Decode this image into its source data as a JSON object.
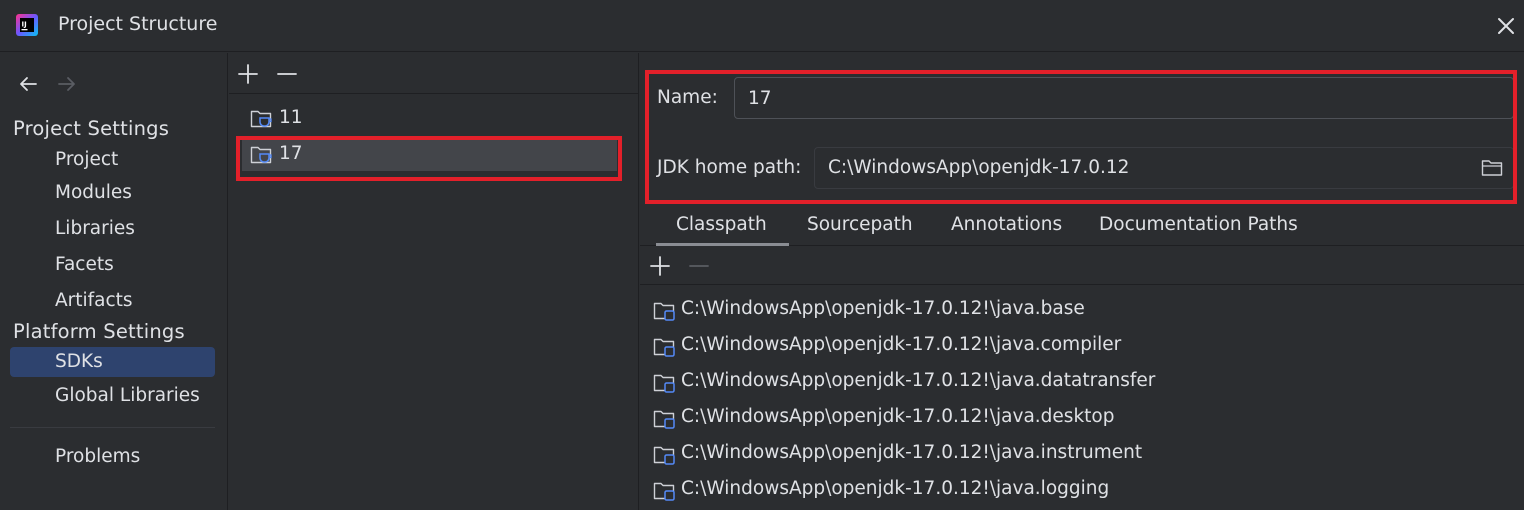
{
  "window": {
    "title": "Project Structure"
  },
  "sidebar": {
    "project_settings_label": "Project Settings",
    "platform_settings_label": "Platform Settings",
    "items": [
      {
        "label": "Project"
      },
      {
        "label": "Modules"
      },
      {
        "label": "Libraries"
      },
      {
        "label": "Facets"
      },
      {
        "label": "Artifacts"
      },
      {
        "label": "SDKs"
      },
      {
        "label": "Global Libraries"
      },
      {
        "label": "Problems"
      }
    ],
    "selected": "SDKs"
  },
  "sdk_list": {
    "items": [
      {
        "label": "11"
      },
      {
        "label": "17"
      }
    ],
    "selected": "17"
  },
  "details": {
    "name_label": "Name:",
    "name_value": "17",
    "home_label": "JDK home path:",
    "home_value": "C:\\WindowsApp\\openjdk-17.0.12"
  },
  "tabs": [
    {
      "label": "Classpath"
    },
    {
      "label": "Sourcepath"
    },
    {
      "label": "Annotations"
    },
    {
      "label": "Documentation Paths"
    }
  ],
  "active_tab": "Classpath",
  "classpath": [
    "C:\\WindowsApp\\openjdk-17.0.12!\\java.base",
    "C:\\WindowsApp\\openjdk-17.0.12!\\java.compiler",
    "C:\\WindowsApp\\openjdk-17.0.12!\\java.datatransfer",
    "C:\\WindowsApp\\openjdk-17.0.12!\\java.desktop",
    "C:\\WindowsApp\\openjdk-17.0.12!\\java.instrument",
    "C:\\WindowsApp\\openjdk-17.0.12!\\java.logging"
  ],
  "colors": {
    "background": "#2b2d30",
    "selection": "#2e436e",
    "list_selection": "#43454a",
    "highlight_box": "#e3202a",
    "icon_blue": "#548af7"
  }
}
